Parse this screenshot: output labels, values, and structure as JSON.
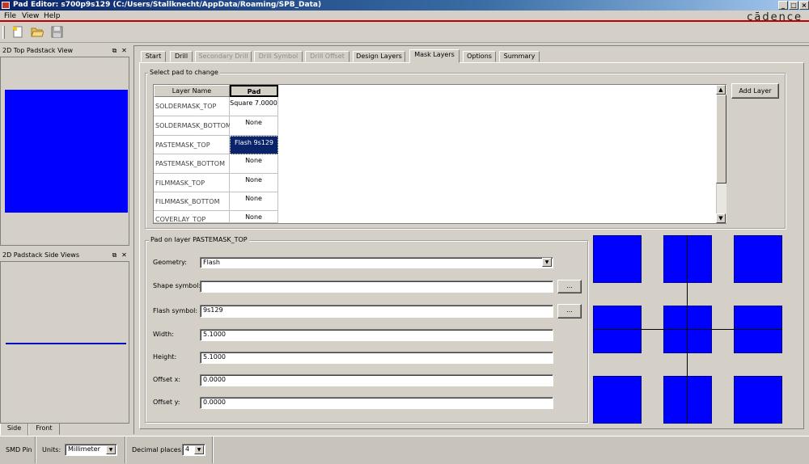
{
  "window": {
    "title": "Pad Editor: s700p9s129  (C:/Users/Stallknecht/AppData/Roaming/SPB_Data)",
    "brand": "cādence"
  },
  "menu": {
    "items": [
      "File",
      "View",
      "Help"
    ]
  },
  "toolbar": {
    "buttons": [
      "new-icon",
      "open-icon",
      "save-icon"
    ]
  },
  "left_panels": {
    "top_view_title": "2D Top Padstack View",
    "side_view_title": "2D Padstack Side Views",
    "side_tabs": [
      "Side",
      "Front"
    ],
    "top_view_fill": "#0000ff"
  },
  "tabs": [
    "Start",
    "Drill",
    "Secondary Drill",
    "Drill Symbol",
    "Drill Offset",
    "Design Layers",
    "Mask Layers",
    "Options",
    "Summary"
  ],
  "active_tab": "Mask Layers",
  "select_group": {
    "label": "Select pad to change",
    "columns": [
      "Layer Name",
      "Pad"
    ],
    "rows": [
      {
        "layer": "SOLDERMASK_TOP",
        "pad": "Square 7.0000"
      },
      {
        "layer": "SOLDERMASK_BOTTOM",
        "pad": "None"
      },
      {
        "layer": "PASTEMASK_TOP",
        "pad": "Flash 9s129"
      },
      {
        "layer": "PASTEMASK_BOTTOM",
        "pad": "None"
      },
      {
        "layer": "FILMMASK_TOP",
        "pad": "None"
      },
      {
        "layer": "FILMMASK_BOTTOM",
        "pad": "None"
      },
      {
        "layer": "COVERLAY_TOP",
        "pad": "None"
      }
    ],
    "selected_row": "PASTEMASK_TOP",
    "add_layer_label": "Add Layer"
  },
  "pad_group": {
    "label": "Pad on layer PASTEMASK_TOP",
    "geometry_label": "Geometry:",
    "geometry_value": "Flash",
    "shape_symbol_label": "Shape symbol:",
    "shape_symbol_value": "",
    "flash_symbol_label": "Flash symbol:",
    "flash_symbol_value": "9s129",
    "browse_label": "...",
    "width_label": "Width:",
    "width_value": "5.1000",
    "height_label": "Height:",
    "height_value": "5.1000",
    "offset_x_label": "Offset x:",
    "offset_x_value": "0.0000",
    "offset_y_label": "Offset y:",
    "offset_y_value": "0.0000"
  },
  "preview": {
    "pad_color": "#0000ff"
  },
  "statusbar": {
    "pin_type": "SMD Pin",
    "units_label": "Units:",
    "units_value": "Millimeter",
    "decimal_label": "Decimal places:",
    "decimal_value": "4"
  }
}
